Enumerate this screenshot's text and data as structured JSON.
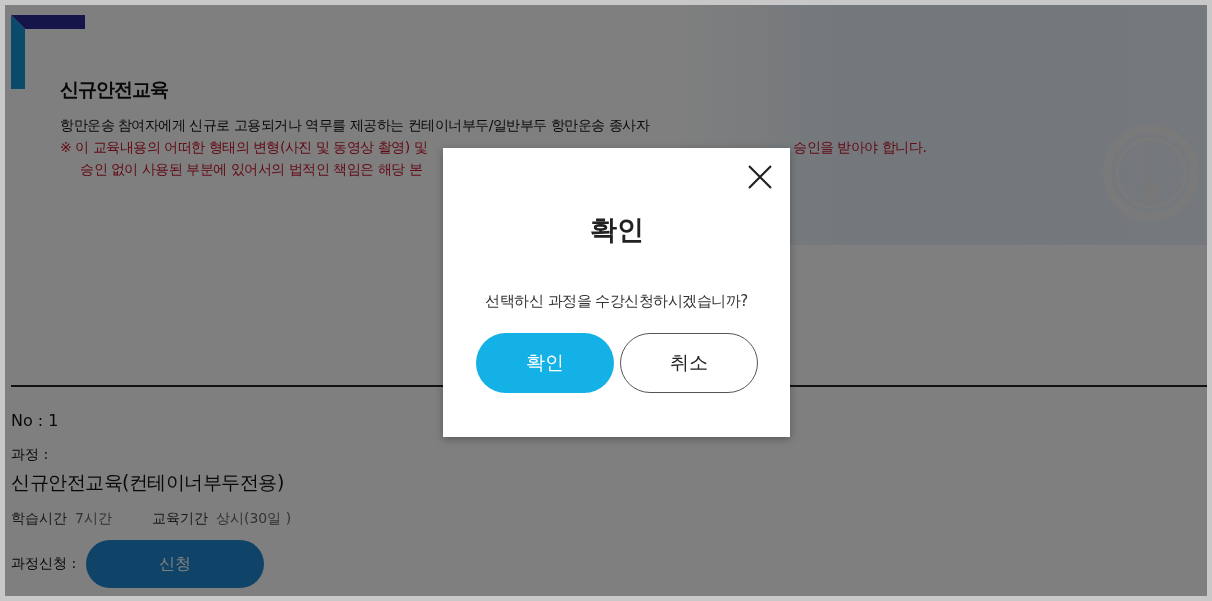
{
  "header": {
    "title": "신규안전교육",
    "description": "항만운송 참여자에게 신규로 고용되거나 역무를 제공하는 컨테이너부두/일반부두 항만운송 종사자",
    "notice_lines": [
      {
        "left": "※ 이 교육내용의 어떠한 형태의 변형(사진 및 동영상 촬영) 및",
        "right": "승인을 받아야 합니다."
      },
      {
        "left": "승인 없이 사용된 부분에 있어서의 법적인 책임은 해당 본"
      }
    ]
  },
  "course": {
    "no": "No : 1",
    "course_label": "과정 :",
    "course_name": "신규안전교육(컨테이너부두전용)",
    "study_time_label": "학습시간",
    "study_time": "7시간",
    "period_label": "교육기간",
    "period": "상시(30일 )",
    "apply_label": "과정신청 :",
    "apply_button": "신청"
  },
  "dialog": {
    "title": "확인",
    "message": "선택하신 과정을 수강신청하시겠습니까?",
    "buttons": [
      {
        "label": "확인",
        "kind": "primary"
      },
      {
        "label": "취소",
        "kind": "secondary"
      }
    ]
  }
}
